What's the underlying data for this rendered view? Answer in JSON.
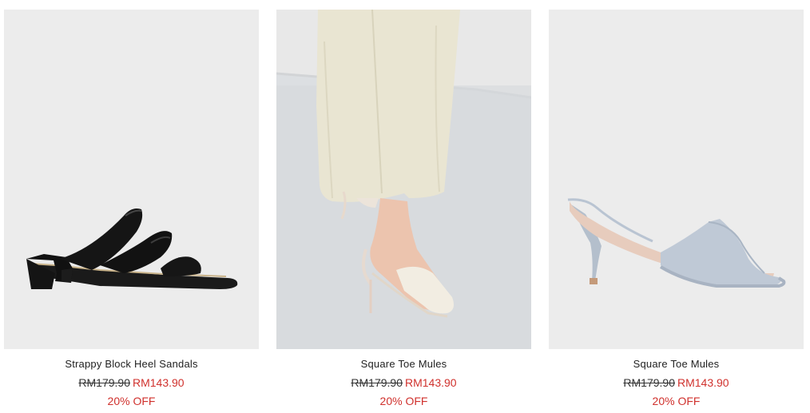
{
  "products": [
    {
      "name": "Strappy Block Heel Sandals",
      "original_price": "RM179.90",
      "sale_price": "RM143.90",
      "discount": "20% OFF",
      "image": "black-strappy-block-heel-sandal-photo"
    },
    {
      "name": "Square Toe Mules",
      "original_price": "RM179.90",
      "sale_price": "RM143.90",
      "discount": "20% OFF",
      "image": "cream-square-toe-mule-worn-photo"
    },
    {
      "name": "Square Toe Mules",
      "original_price": "RM179.90",
      "sale_price": "RM143.90",
      "discount": "20% OFF",
      "image": "blue-square-toe-mule-photo"
    }
  ],
  "colors": {
    "sale": "#d0312d",
    "image_bg": "#ededed"
  }
}
